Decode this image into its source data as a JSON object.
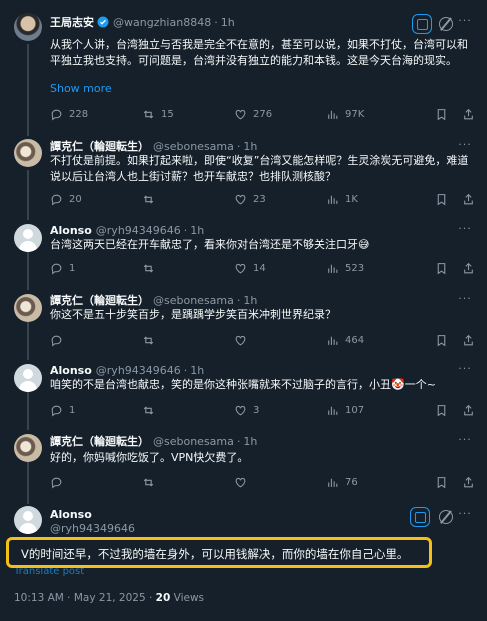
{
  "tweets": [
    {
      "name": "王局志安",
      "handle": "@wangzhian8848",
      "time": "1h",
      "verified": true,
      "text": "从我个人讲，台湾独立与否我是完全不在意的，甚至可以说，如果不打仗，台湾可以和平独立我也支持。可问题是，台湾并没有独立的能力和本钱。这是今天台海的现实。",
      "show_more": "Show more",
      "replies": "228",
      "reposts": "15",
      "likes": "276",
      "views": "97K"
    },
    {
      "name": "譚克仁（輪廻転生）",
      "handle": "@sebonesama",
      "time": "1h",
      "text": "不打仗是前提。如果打起来啦，即使“收复”台湾又能怎样呢？生灵涂炭无可避免，难道说以后让台湾人也上街讨薪？也开车献忠？也排队测核酸？",
      "replies": "20",
      "reposts": "",
      "likes": "23",
      "views": "1K"
    },
    {
      "name": "Alonso",
      "handle": "@ryh94349646",
      "time": "1h",
      "text": "台湾这两天已经在开车献忠了，看来你对台湾还是不够关注口牙😅",
      "replies": "1",
      "reposts": "",
      "likes": "14",
      "views": "523"
    },
    {
      "name": "譚克仁（輪廻転生）",
      "handle": "@sebonesama",
      "time": "1h",
      "text": "你这不是五十步笑百步，是踽踽学步笑百米冲刺世界纪录？",
      "replies": "",
      "reposts": "",
      "likes": "",
      "views": "464"
    },
    {
      "name": "Alonso",
      "handle": "@ryh94349646",
      "time": "1h",
      "text": "咱笑的不是台湾也献忠，笑的是你这种张嘴就来不过脑子的言行，小丑🤡一个~",
      "replies": "1",
      "reposts": "",
      "likes": "3",
      "views": "107"
    },
    {
      "name": "譚克仁（輪廻転生）",
      "handle": "@sebonesama",
      "time": "1h",
      "text": "好的，你妈喊你吃饭了。VPN快欠费了。",
      "replies": "",
      "reposts": "",
      "likes": "",
      "views": "76"
    }
  ],
  "main": {
    "name": "Alonso",
    "handle": "@ryh94349646",
    "text": "V的时间还早，不过我的墙在身外，可以用钱解决，而你的墙在你自己心里。",
    "translate": "Translate post",
    "time": "10:13 AM · May 21, 2025 · ",
    "views_count": "20",
    "views_label": " Views"
  },
  "colors": {
    "background": "#15202b",
    "accent": "#1d9bf0",
    "muted": "#8b98a5",
    "highlight": "#f5bf1a"
  }
}
